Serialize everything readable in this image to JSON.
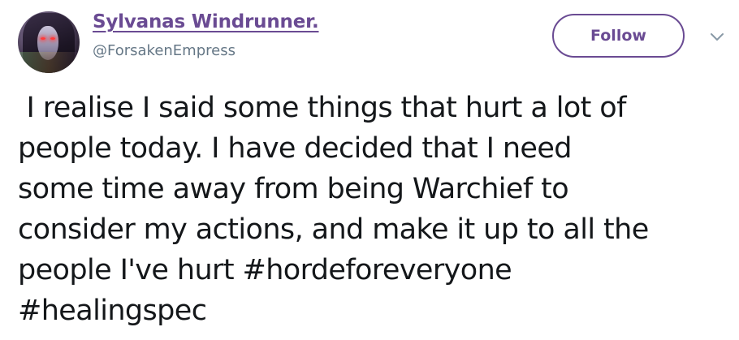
{
  "author": {
    "display_name": "Sylvanas Windrunner.",
    "handle": "@ForsakenEmpress",
    "avatar_icon": "avatar-image"
  },
  "actions": {
    "follow_label": "Follow",
    "more_icon": "chevron-down-icon"
  },
  "tweet": {
    "lines": [
      " I realise I said some things that hurt a lot of",
      "people today. I have decided that I need",
      "some time away from being Warchief to",
      "consider my actions, and make it up to all the",
      "people I've hurt "
    ],
    "hashtags": [
      "#hordeforeveryone",
      "#healingspec"
    ]
  },
  "colors": {
    "accent": "#6a4b93",
    "text": "#14171a",
    "muted": "#657786"
  }
}
